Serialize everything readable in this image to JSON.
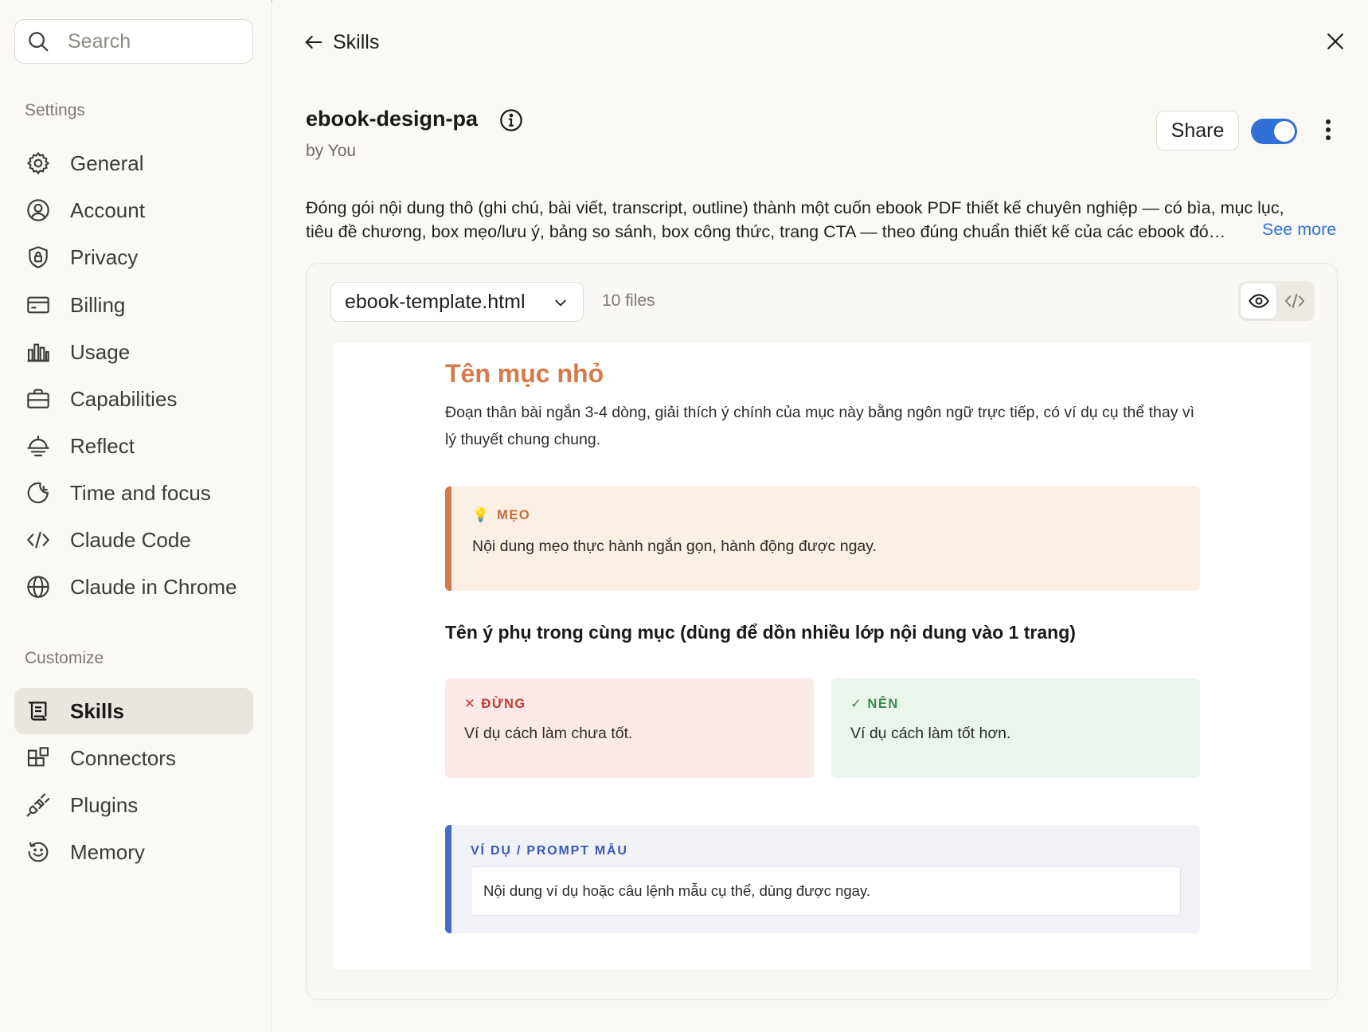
{
  "sidebar": {
    "search_placeholder": "Search",
    "settings_label": "Settings",
    "settings_items": [
      {
        "label": "General",
        "icon": "gear-icon"
      },
      {
        "label": "Account",
        "icon": "user-circle-icon"
      },
      {
        "label": "Privacy",
        "icon": "shield-lock-icon"
      },
      {
        "label": "Billing",
        "icon": "credit-card-icon"
      },
      {
        "label": "Usage",
        "icon": "bar-chart-icon"
      },
      {
        "label": "Capabilities",
        "icon": "briefcase-icon"
      },
      {
        "label": "Reflect",
        "icon": "reflect-icon"
      },
      {
        "label": "Time and focus",
        "icon": "moon-clock-icon"
      },
      {
        "label": "Claude Code",
        "icon": "code-icon"
      },
      {
        "label": "Claude in Chrome",
        "icon": "globe-icon"
      }
    ],
    "customize_label": "Customize",
    "customize_items": [
      {
        "label": "Skills",
        "icon": "scroll-icon",
        "active": true
      },
      {
        "label": "Connectors",
        "icon": "blocks-icon"
      },
      {
        "label": "Plugins",
        "icon": "plug-icon"
      },
      {
        "label": "Memory",
        "icon": "memory-icon"
      }
    ]
  },
  "header": {
    "back_label": "Skills"
  },
  "skill": {
    "title": "ebook-design-pa",
    "author": "by You",
    "share_label": "Share",
    "enabled": true,
    "description_line1": "Đóng gói nội dung thô (ghi chú, bài viết, transcript, outline) thành một cuốn ebook PDF thiết kế chuyên nghiệp — có bìa, mục lục,",
    "description_line2": "tiêu đề chương, box mẹo/lưu ý, bảng so sánh, box công thức, trang CTA — theo đúng chuẩn thiết kế của các ebook đó…",
    "see_more": "See more"
  },
  "viewer": {
    "file_name": "ebook-template.html",
    "file_count": "10 files",
    "mode": "preview"
  },
  "preview": {
    "heading": "Tên mục nhỏ",
    "body": "Đoạn thân bài ngắn 3-4 dòng, giải thích ý chính của mục này bằng ngôn ngữ trực tiếp, có ví dụ cụ thể thay vì lý thuyết chung chung.",
    "tip_label": "MẸO",
    "tip_text": "Nội dung mẹo thực hành ngắn gọn, hành động được ngay.",
    "subheading": "Tên ý phụ trong cùng mục (dùng để dồn nhiều lớp nội dung vào 1 trang)",
    "dont_label": "✕ ĐỪNG",
    "dont_text": "Ví dụ cách làm chưa tốt.",
    "do_label": "✓ NÊN",
    "do_text": "Ví dụ cách làm tốt hơn.",
    "example_label": "VÍ DỤ / PROMPT MẪU",
    "example_text": "Nội dung ví dụ hoặc câu lệnh mẫu cụ thể, dùng được ngay."
  },
  "colors": {
    "accent_blue": "#2f6fd6",
    "preview_orange": "#d77a4a",
    "example_blue": "#4a67c9",
    "dont_red": "#c53a33",
    "do_green": "#3b8a4e"
  }
}
